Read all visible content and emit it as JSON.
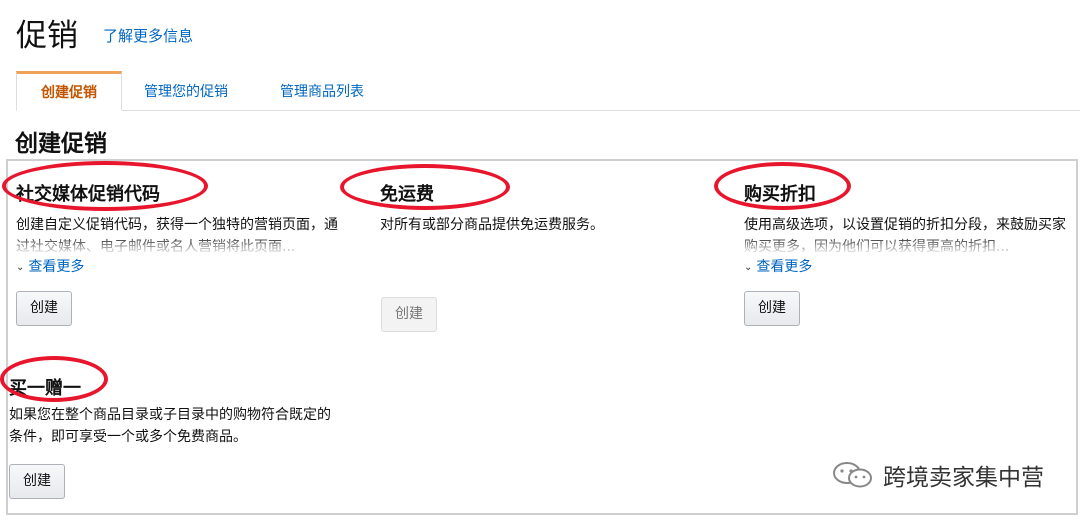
{
  "header": {
    "title": "促销",
    "learn_more": "了解更多信息"
  },
  "tabs": [
    {
      "label": "创建促销",
      "active": true
    },
    {
      "label": "管理您的促销",
      "active": false
    },
    {
      "label": "管理商品列表",
      "active": false
    }
  ],
  "section": {
    "title": "创建促销"
  },
  "cards": [
    {
      "title": "社交媒体促销代码",
      "description": "创建自定义促销代码，获得一个独特的营销页面，通过社交媒体、电子邮件或名人营销将此页面...",
      "see_more": "查看更多",
      "button": "创建",
      "button_enabled": true
    },
    {
      "title": "免运费",
      "description": "对所有或部分商品提供免运费服务。",
      "button": "创建",
      "button_enabled": false
    },
    {
      "title": "购买折扣",
      "description": "使用高级选项，以设置促销的折扣分段，来鼓励买家购买更多，因为他们可以获得更高的折扣...",
      "see_more": "查看更多",
      "button": "创建",
      "button_enabled": true
    },
    {
      "title": "买一赠一",
      "description": "如果您在整个商品目录或子目录中的购物符合既定的条件，即可享受一个或多个免费商品。",
      "button": "创建",
      "button_enabled": true
    }
  ],
  "watermark": {
    "text": "跨境卖家集中营"
  },
  "colors": {
    "link": "#0066c0",
    "active_tab": "#c45500",
    "tab_accent": "#f0a25a",
    "annotation": "#e8162c"
  }
}
